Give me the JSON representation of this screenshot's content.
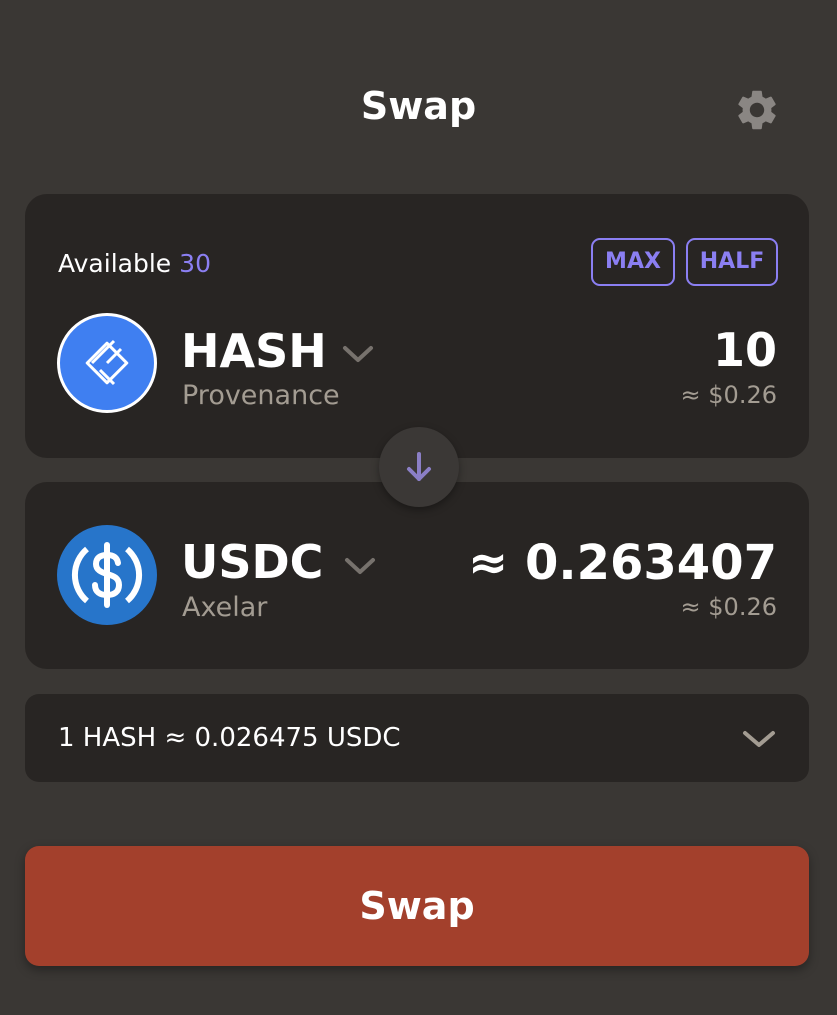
{
  "header": {
    "title": "Swap",
    "settings_icon": "gear-icon"
  },
  "from": {
    "available_label": "Available",
    "available_value": "30",
    "max_label": "MAX",
    "half_label": "HALF",
    "token_symbol": "HASH",
    "token_chain": "Provenance",
    "token_icon": "hash-token-icon",
    "amount": "10",
    "usd_value": "≈ $0.26"
  },
  "switch_icon": "arrow-down-icon",
  "to": {
    "token_symbol": "USDC",
    "token_chain": "Axelar",
    "token_icon": "usdc-token-icon",
    "amount": "≈ 0.263407",
    "usd_value": "≈ $0.26"
  },
  "rate": {
    "text": "1 HASH ≈ 0.026475 USDC",
    "expand_icon": "chevron-down-icon"
  },
  "swap_button": {
    "label": "Swap"
  },
  "colors": {
    "background": "#3a3734",
    "card": "#282523",
    "accent": "#8b7ff2",
    "muted_text": "#a39c92",
    "swap_button": "#a3402c",
    "hash_blue": "#3f7ff1",
    "usdc_blue": "#2775ca"
  }
}
